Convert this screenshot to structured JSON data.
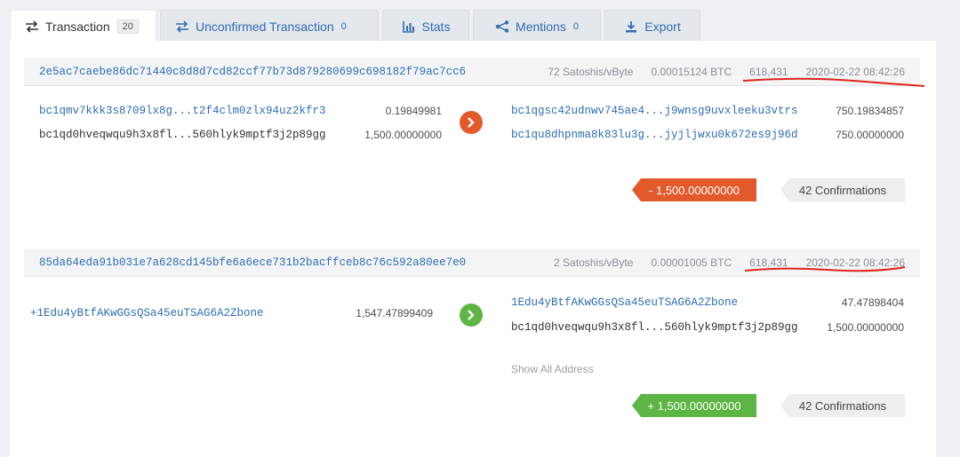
{
  "tabs": [
    {
      "label": "Transaction",
      "count": "20",
      "icon": "swap-arrows-icon"
    },
    {
      "label": "Unconfirmed Transaction",
      "count": "0",
      "icon": "swap-arrows-icon"
    },
    {
      "label": "Stats",
      "icon": "bar-chart-icon"
    },
    {
      "label": "Mentions",
      "count": "0",
      "icon": "share-icon"
    },
    {
      "label": "Export",
      "icon": "download-icon"
    }
  ],
  "transactions": [
    {
      "hash": "2e5ac7caebe86dc71440c8d8d7cd82ccf77b73d879280699c698182f79ac7cc6",
      "fee_rate": "72 Satoshis/vByte",
      "fee": "0.00015124 BTC",
      "block": "618,431",
      "time": "2020-02-22 08:42:26",
      "inputs": [
        {
          "address": "bc1qmv7kkk3s8709lx8g...t2f4clm0zlx94uz2kfr3",
          "amount": "0.19849981"
        },
        {
          "address": "bc1qd0hveqwqu9h3x8fl...560hlyk9mptf3j2p89gg",
          "amount": "1,500.00000000"
        }
      ],
      "outputs": [
        {
          "address": "bc1qgsc42udnwv745ae4...j9wnsg9uvxleeku3vtrs",
          "amount": "750.19834857"
        },
        {
          "address": "bc1qu8dhpnma8k83lu3g...jyjljwxu0k672es9j96d",
          "amount": "750.00000000"
        }
      ],
      "result": "- 1,500.00000000",
      "confirmations": "42 Confirmations"
    },
    {
      "hash": "85da64eda91b031e7a628cd145bfe6a6ece731b2bacffceb8c76c592a80ee7e0",
      "fee_rate": "2 Satoshis/vByte",
      "fee": "0.00001005 BTC",
      "block": "618,431",
      "time": "2020-02-22 08:42:26",
      "inputs": [
        {
          "address": "+1Edu4yBtfAKwGGsQSa45euTSAG6A2Zbone",
          "amount": "1,547.47899409"
        }
      ],
      "outputs": [
        {
          "address": "1Edu4yBtfAKwGGsQSa45euTSAG6A2Zbone",
          "amount": "47.47898404"
        },
        {
          "address": "bc1qd0hveqwqu9h3x8fl...560hlyk9mptf3j2p89gg",
          "amount": "1,500.00000000"
        }
      ],
      "show_all": "Show All Address",
      "result": "+ 1,500.00000000",
      "confirmations": "42 Confirmations"
    }
  ],
  "colors": {
    "link": "#2f6db3",
    "outgoing": "#e25a2c",
    "incoming": "#5cb545",
    "annotation": "#e0241b"
  }
}
